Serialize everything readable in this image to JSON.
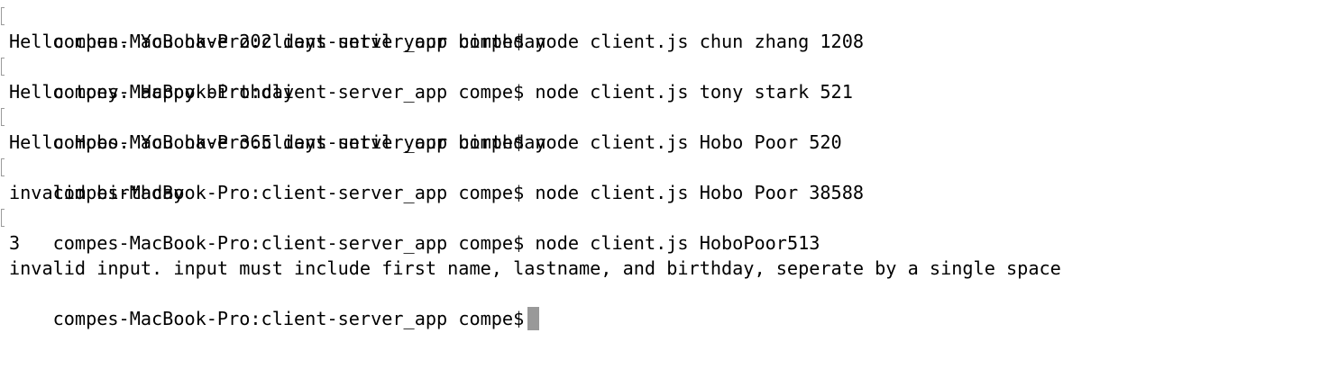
{
  "terminal": {
    "prompt": "compes-MacBook-Pro:client-server_app compe$",
    "commands": [
      "node client.js chun zhang 1208",
      "node client.js tony stark 521",
      "node client.js Hobo Poor 520",
      "node client.js Hobo Poor 38588",
      "node client.js HoboPoor513"
    ],
    "outputs": [
      "Hello chun. You have 202 days until your birthday",
      "Hello tony. Happy birthday",
      "Hello Hobo. You have 365 days until your birthday",
      "invalid birthday",
      "3",
      "invalid input. input must include first name, lastname, and birthday, seperate by a single space"
    ]
  }
}
